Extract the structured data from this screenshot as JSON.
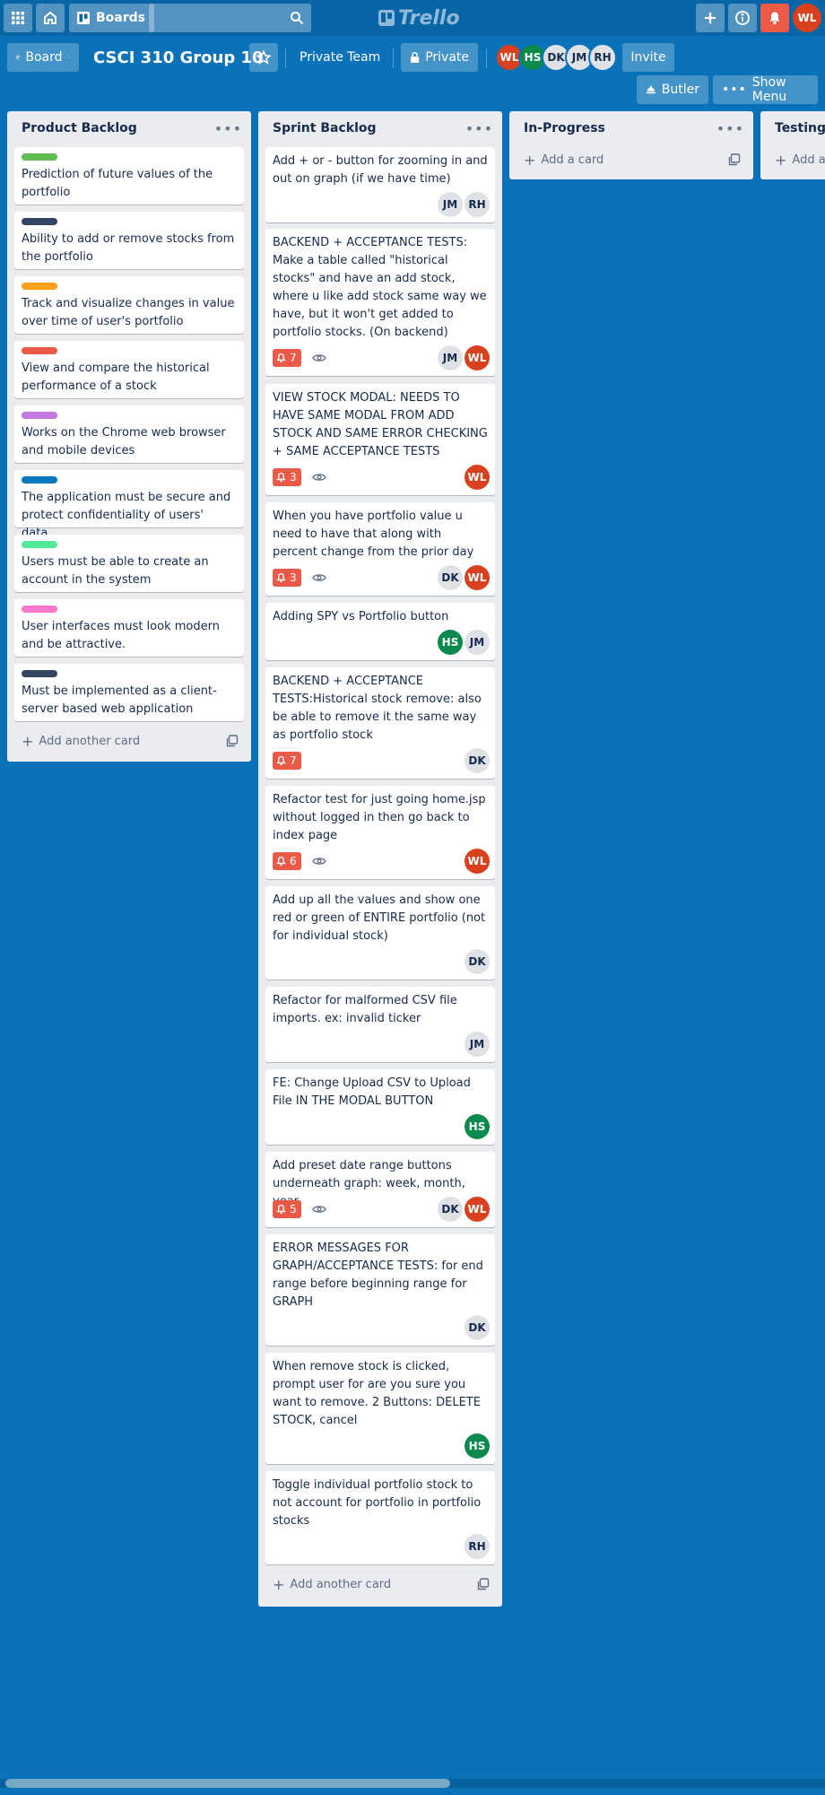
{
  "header": {
    "boards_label": "Boards",
    "search_placeholder": "",
    "logo_text": "Trello",
    "user_initials": "WL"
  },
  "board": {
    "board_view_label": "Board",
    "title": "CSCI 310 Group 10",
    "team_label": "Private Team",
    "visibility_label": "Private",
    "members": [
      "WL",
      "HS",
      "DK",
      "JM",
      "RH"
    ],
    "invite_label": "Invite",
    "butler_label": "Butler",
    "show_menu_label": "Show Menu"
  },
  "colors": {
    "background": "#0a72b8",
    "label_green": "#61bd4f",
    "label_navy": "#344563",
    "label_orange": "#ff9f1a",
    "label_red": "#eb5a46",
    "label_purple": "#c377e0",
    "label_blue": "#0079bf",
    "label_lime": "#51e898",
    "label_pink": "#ff78cb",
    "avatar_wl": "#d9411e",
    "avatar_hs": "#0b8a4d"
  },
  "lists": [
    {
      "title": "Product Backlog",
      "add_label": "Add another card",
      "cards": [
        {
          "label_color": "#61bd4f",
          "text": "Prediction of future values of the portfolio"
        },
        {
          "label_color": "#344563",
          "text": "Ability to add or remove stocks from the portfolio"
        },
        {
          "label_color": "#ff9f1a",
          "text": "Track and visualize changes in value over time of user's portfolio"
        },
        {
          "label_color": "#eb5a46",
          "text": "View and compare the historical performance of a stock"
        },
        {
          "label_color": "#c377e0",
          "text": "Works on the Chrome web browser and mobile devices"
        },
        {
          "label_color": "#0079bf",
          "text": "The application must be secure and protect confidentiality of users' data."
        },
        {
          "label_color": "#51e898",
          "text": "Users must be able to create an account in the system"
        },
        {
          "label_color": "#ff78cb",
          "text": "User interfaces must look modern and be attractive."
        },
        {
          "label_color": "#344563",
          "text": "Must be implemented as a client-server based web application"
        }
      ]
    },
    {
      "title": "Sprint Backlog",
      "add_label": "Add another card",
      "cards": [
        {
          "text": "Add + or - button for zooming in and out on graph (if we have time)",
          "members": [
            "JM",
            "RH"
          ]
        },
        {
          "text": "BACKEND + ACCEPTANCE TESTS: Make a table called \"historical stocks\" and have an add stock, where u like add stock same way we have, but it won't get added to portfolio stocks. (On backend)",
          "badge": "7",
          "watch": true,
          "members": [
            "JM",
            "WL"
          ]
        },
        {
          "text": "VIEW STOCK MODAL: NEEDS TO HAVE SAME MODAL FROM ADD STOCK AND SAME ERROR CHECKING + SAME ACCEPTANCE TESTS",
          "badge": "3",
          "watch": true,
          "members": [
            "WL"
          ]
        },
        {
          "text": "When you have portfolio value u need to have that along with percent change from the prior day",
          "badge": "3",
          "watch": true,
          "members": [
            "DK",
            "WL"
          ]
        },
        {
          "text": "Adding SPY vs Portfolio button",
          "members": [
            "HS",
            "JM"
          ]
        },
        {
          "text": "BACKEND + ACCEPTANCE TESTS:Historical stock remove: also be able to remove it the same way as portfolio stock",
          "badge": "7",
          "members": [
            "DK"
          ]
        },
        {
          "text": "Refactor test for just going home.jsp without logged in then go back to index page",
          "badge": "6",
          "watch": true,
          "members": [
            "WL"
          ]
        },
        {
          "text": "Add up all the values and show one red or green of ENTIRE portfolio (not for individual stock)",
          "members": [
            "DK"
          ]
        },
        {
          "text": "Refactor for malformed CSV file imports. ex: invalid ticker",
          "members": [
            "JM"
          ]
        },
        {
          "text": "FE: Change Upload CSV to Upload File IN THE MODAL BUTTON",
          "members": [
            "HS"
          ]
        },
        {
          "text": "Add preset date range buttons underneath graph: week, month, year",
          "badge": "5",
          "watch": true,
          "members": [
            "DK",
            "WL"
          ]
        },
        {
          "text": "ERROR MESSAGES FOR GRAPH/ACCEPTANCE TESTS: for end range before beginning range for GRAPH",
          "members": [
            "DK"
          ]
        },
        {
          "text": "When remove stock is clicked, prompt user for are you sure you want to remove. 2 Buttons: DELETE STOCK, cancel",
          "members": [
            "HS"
          ]
        },
        {
          "text": "Toggle individual portfolio stock to not account for portfolio in portfolio stocks",
          "members": [
            "RH"
          ]
        }
      ]
    },
    {
      "title": "In-Progress",
      "add_label": "Add a card"
    },
    {
      "title": "Testing",
      "add_label": "Add a card"
    }
  ]
}
